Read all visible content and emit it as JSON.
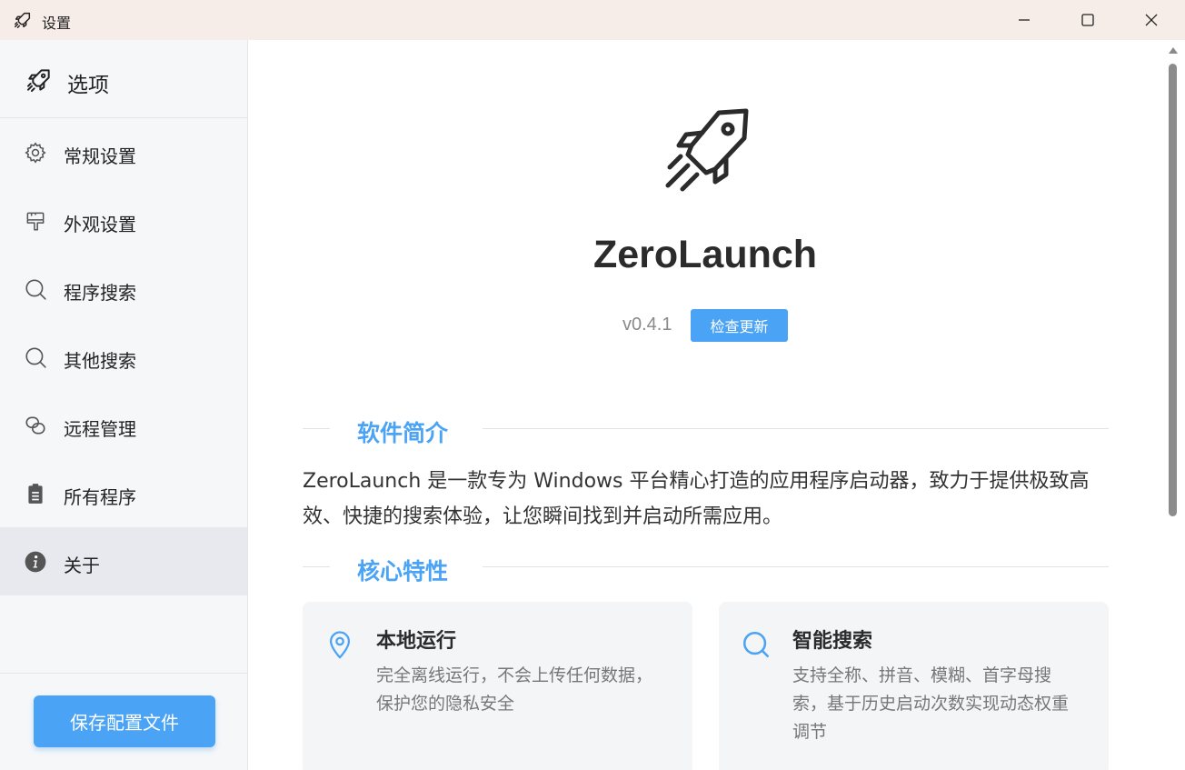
{
  "window": {
    "title": "设置",
    "icons": {
      "app": "rocket-icon",
      "minimize": "minimize-icon",
      "maximize": "maximize-icon",
      "close": "close-icon"
    }
  },
  "sidebar": {
    "header": {
      "label": "选项",
      "icon": "rocket-icon"
    },
    "items": [
      {
        "label": "常规设置",
        "icon": "gear-icon"
      },
      {
        "label": "外观设置",
        "icon": "paint-brush-icon"
      },
      {
        "label": "程序搜索",
        "icon": "search-icon"
      },
      {
        "label": "其他搜索",
        "icon": "search-icon"
      },
      {
        "label": "远程管理",
        "icon": "link-icon"
      },
      {
        "label": "所有程序",
        "icon": "clipboard-icon"
      },
      {
        "label": "关于",
        "icon": "info-icon",
        "active": true
      }
    ],
    "save_button": "保存配置文件"
  },
  "about": {
    "app_name": "ZeroLaunch",
    "version": "v0.4.1",
    "check_update": "检查更新",
    "intro_title": "软件简介",
    "intro_text": "ZeroLaunch 是一款专为 Windows 平台精心打造的应用程序启动器，致力于提供极致高效、快捷的搜索体验，让您瞬间找到并启动所需应用。",
    "features_title": "核心特性",
    "features": [
      {
        "title": "本地运行",
        "desc": "完全离线运行，不会上传任何数据，保护您的隐私安全",
        "icon": "location-pin-icon"
      },
      {
        "title": "智能搜索",
        "desc": "支持全称、拼音、模糊、首字母搜索，基于历史启动次数实现动态权重调节",
        "icon": "search-icon"
      }
    ]
  },
  "colors": {
    "accent": "#4aa3f5",
    "titlebar": "#f7ede8",
    "sidebar": "#f6f7f9",
    "active_item": "#e7e9ee"
  }
}
